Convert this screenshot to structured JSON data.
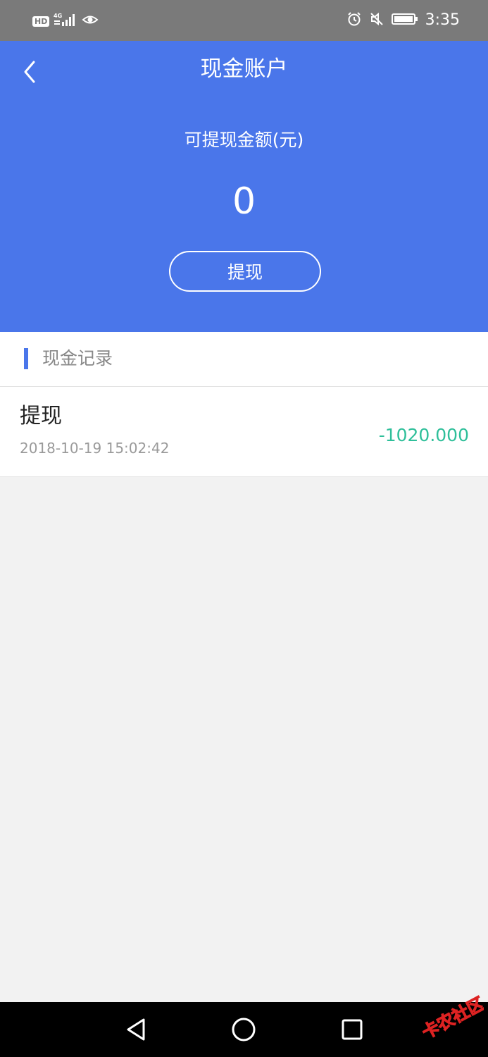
{
  "status_bar": {
    "hd": "HD",
    "network": "4G",
    "time": "3:35",
    "icons": [
      "hd-icon",
      "signal-icon",
      "eye-icon",
      "alarm-icon",
      "mute-icon",
      "battery-icon"
    ]
  },
  "header": {
    "title": "现金账户",
    "amount_label": "可提现金额(元)",
    "amount_value": "0",
    "withdraw_label": "提现"
  },
  "records": {
    "section_title": "现金记录",
    "items": [
      {
        "type": "提现",
        "time": "2018-10-19 15:02:42",
        "amount": "-1020.000"
      }
    ]
  },
  "colors": {
    "header_bg": "#4a76ea",
    "accent": "#4a76ea",
    "amount_negative": "#2fbf9a",
    "page_bg": "#f2f2f2"
  },
  "nav": {
    "icons": [
      "back-triangle-icon",
      "home-circle-icon",
      "recents-square-icon"
    ]
  },
  "watermark": {
    "text": "卡农社区"
  }
}
